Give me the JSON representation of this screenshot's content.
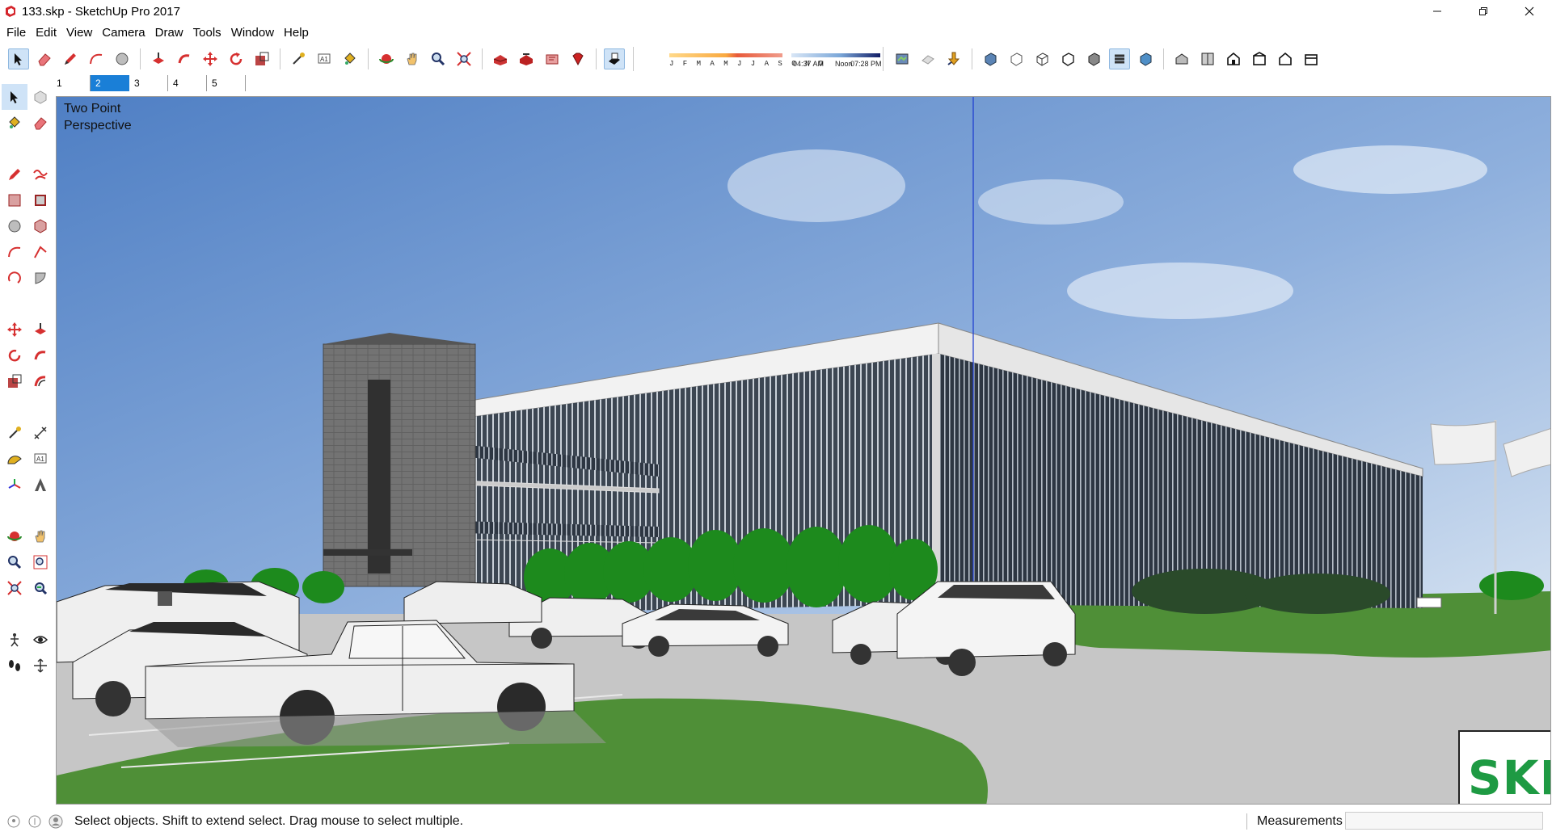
{
  "window": {
    "title": "133.skp - SketchUp Pro 2017",
    "app_icon": "sketchup-icon",
    "controls": [
      "minimize-icon",
      "restore-icon",
      "close-icon"
    ]
  },
  "menu": [
    "File",
    "Edit",
    "View",
    "Camera",
    "Draw",
    "Tools",
    "Window",
    "Help"
  ],
  "shadow_settings": {
    "months": "J F M A M J J A S O N D",
    "time_start": "04:37 AM",
    "time_mid": "Noon",
    "time_end": "07:28 PM"
  },
  "scene_tabs": [
    {
      "label": "1",
      "active": false
    },
    {
      "label": "2",
      "active": true
    },
    {
      "label": "3",
      "active": false
    },
    {
      "label": "4",
      "active": false
    },
    {
      "label": "5",
      "active": false
    }
  ],
  "viewport": {
    "camera_label": "Two Point\nPerspective",
    "badge": "SKP"
  },
  "status": {
    "message": "Select objects. Shift to extend select. Drag mouse to select multiple.",
    "measurements_label": "Measurements",
    "measurements_value": ""
  },
  "colors": {
    "sky_top": "#4f7fc4",
    "sky_bottom": "#c9daee",
    "grass": "#4f8f37",
    "road": "#c8c8c8",
    "tree": "#1d8a1d",
    "accent_tab": "#1a7fd7",
    "skp_green": "#1e9a43"
  }
}
